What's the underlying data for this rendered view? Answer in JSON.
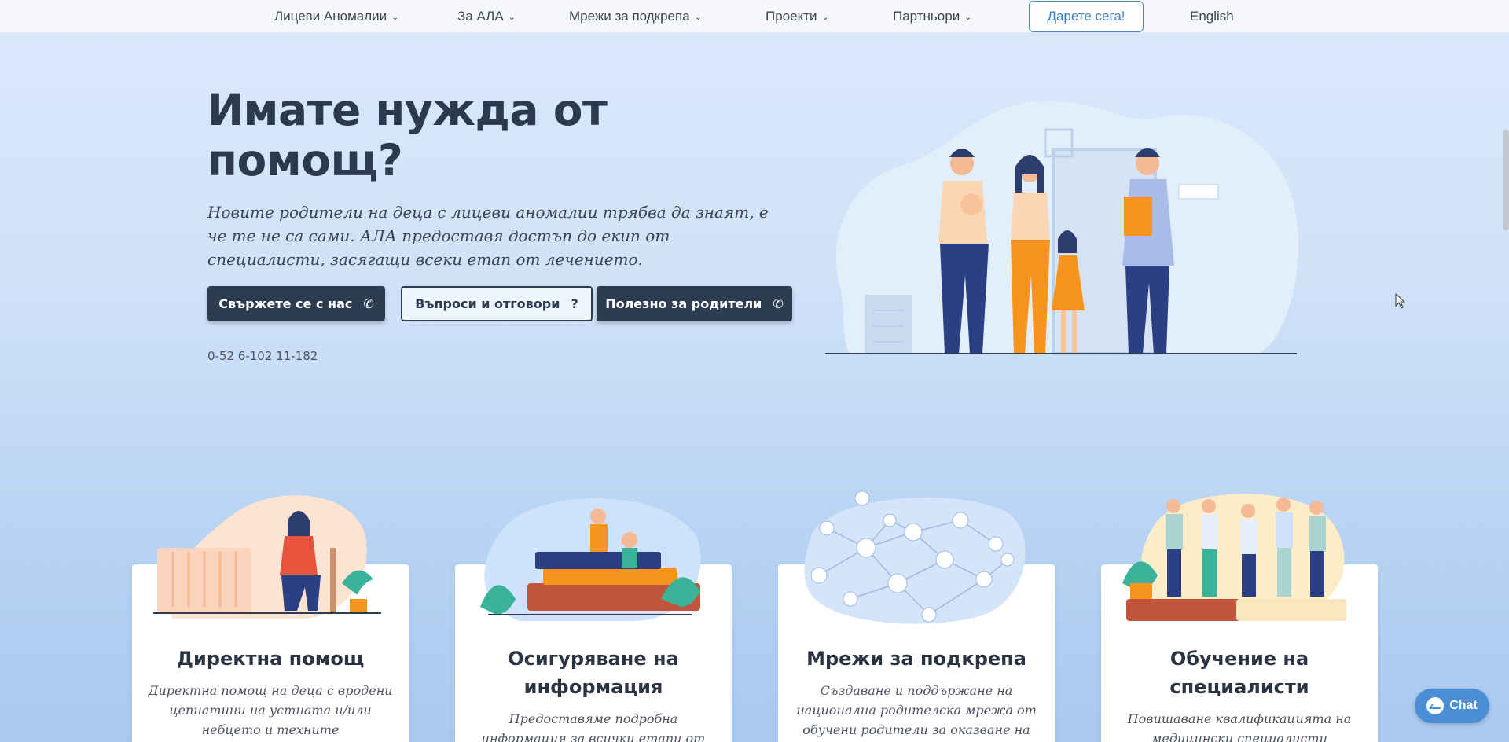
{
  "nav": {
    "items": [
      {
        "label": "Лицеви Аномалии",
        "has_dropdown": true
      },
      {
        "label": "За АЛА",
        "has_dropdown": true
      },
      {
        "label": "Мрежи за подкрепа",
        "has_dropdown": true
      },
      {
        "label": "Проекти",
        "has_dropdown": true
      },
      {
        "label": "Партньори",
        "has_dropdown": true
      }
    ],
    "donate_label": "Дарете сега!",
    "language_label": "English",
    "chevron_icon": "chevron-down-icon"
  },
  "hero": {
    "title": "Имате нужда от помощ?",
    "text": "Новите родители на деца с лицеви аномалии трябва да знаят, е че те не са сами. АЛА предоставя достъп до екип от специалисти, засягащи всеки етап от лечението.",
    "buttons": {
      "contact": "Свържете се с нас",
      "faq": "Въпроси и отговори",
      "useful": "Полезно за родители"
    },
    "phone": "0-52 6-102 11-182"
  },
  "cards": [
    {
      "title": "Директна помощ",
      "text": "Директна помощ на деца с вродени цепнатини на устната и/или небцето и техните"
    },
    {
      "title": "Осигуряване на информация",
      "text": "Предоставяме подробна информация за всички етапи от"
    },
    {
      "title": "Мрежи за подкрепа",
      "text": "Създаване и поддържане на национална родителска мрежа от обучени родители за оказване на"
    },
    {
      "title": "Обучение на специалисти",
      "text": "Повишаване квалификацията на медицински специалисти"
    }
  ],
  "chat": {
    "label": "Chat",
    "icon": "messenger-icon"
  },
  "colors": {
    "accent": "#2c3d52",
    "link": "#3f7fc6",
    "chat": "#4a8fd6",
    "orange": "#f7941d"
  }
}
